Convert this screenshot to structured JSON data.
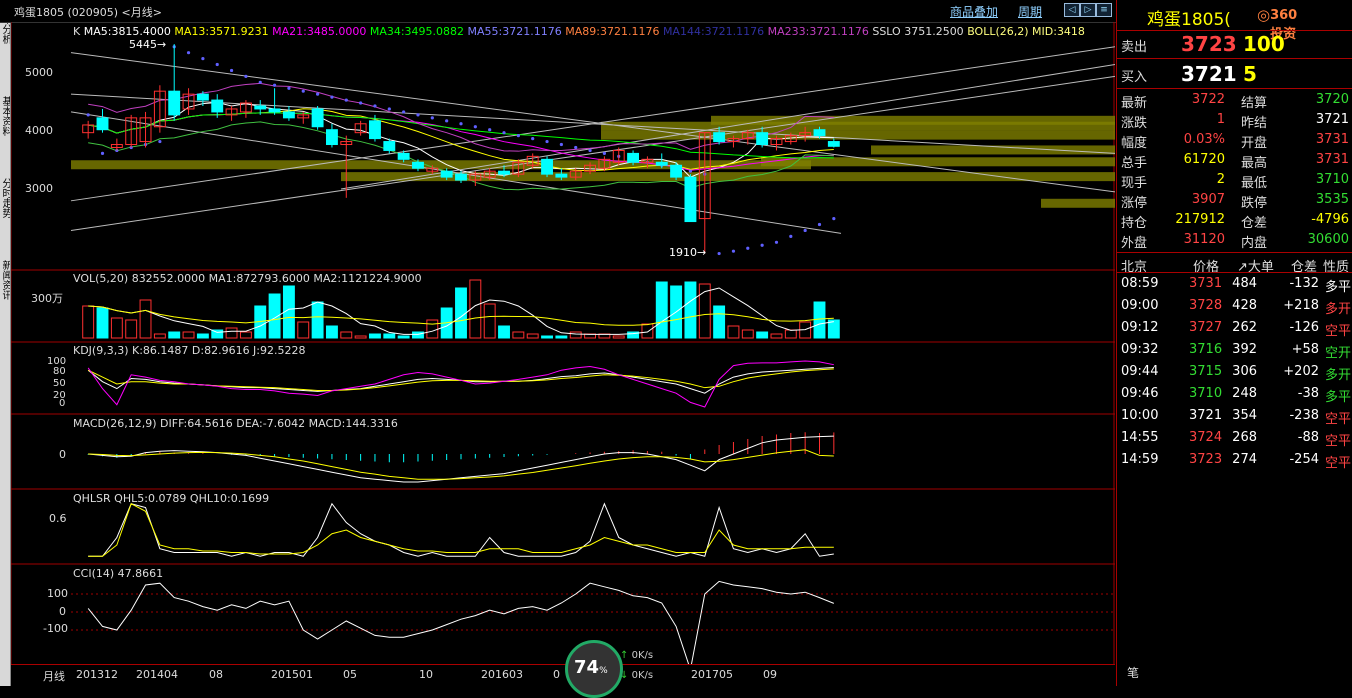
{
  "window": {
    "code_label": "鸡蛋1805 (020905) <月线>",
    "links": [
      "商品叠加",
      "周期"
    ]
  },
  "left_tabs": [
    "技术分析",
    "基本资料",
    "分时走势",
    "新闻资讯"
  ],
  "main": {
    "header": "K  MA5:3815.4000  MA13:3571.9231  MA21:3485.0000  MA34:3495.0882  MA55:3721.1176  MA89:3721.1176  MA144:3721.1176  MA233:3721.1176  SSLO 3751.2500  BOLL(26,2) MID:3418",
    "header_items": [
      {
        "t": "K",
        "c": "#ddd"
      },
      {
        "t": "MA5:3815.4000",
        "c": "#ffffff"
      },
      {
        "t": "MA13:3571.9231",
        "c": "#ffff00"
      },
      {
        "t": "MA21:3485.0000",
        "c": "#ff00ff"
      },
      {
        "t": "MA34:3495.0882",
        "c": "#00ff00"
      },
      {
        "t": "MA55:3721.1176",
        "c": "#8080ff"
      },
      {
        "t": "MA89:3721.1176",
        "c": "#ff8040"
      },
      {
        "t": "MA144:3721.1176",
        "c": "#3030a0"
      },
      {
        "t": "MA233:3721.1176",
        "c": "#c040c0"
      },
      {
        "t": "SSLO 3751.2500",
        "c": "#ddd"
      },
      {
        "t": "BOLL(26,2) MID:3418",
        "c": "#ffff80"
      }
    ],
    "y_labels": [
      "5000",
      "4000",
      "3000"
    ],
    "y_values": [
      5000,
      4000,
      3000
    ],
    "price_range": [
      1700,
      5750
    ],
    "high_marker": "5445",
    "low_marker": "1910"
  },
  "vol": {
    "header": "VOL(5,20) 832552.0000  MA1:872793.6000  MA2:1121224.9000",
    "y_label": "300万"
  },
  "kdj": {
    "header": "KDJ(9,3,3) K:86.1487  D:82.9616  J:92.5228",
    "y_labels": [
      "100",
      "80",
      "50",
      "20",
      "0"
    ]
  },
  "macd": {
    "header": "MACD(26,12,9) DIFF:64.5616  DEA:-7.6042  MACD:144.3316",
    "y_label": "0"
  },
  "qhlsr": {
    "header": "QHLSR  QHL5:0.0789  QHL10:0.1699",
    "y_label": "0.6"
  },
  "cci": {
    "header": "CCI(14) 47.8661",
    "y_labels": [
      "100",
      "0",
      "-100"
    ]
  },
  "x_axis": {
    "period": "月线",
    "labels": [
      "201312",
      "201404",
      "08",
      "201501",
      "05",
      "10",
      "201603",
      "0",
      "201705",
      "09"
    ]
  },
  "gauge": {
    "value": "74",
    "unit": "%",
    "up": "0K/s",
    "down": "0K/s"
  },
  "chart_data": {
    "type": "candlestick",
    "title": "鸡蛋1805 (020905) <月线>",
    "ylim": [
      1700,
      5750
    ],
    "candles": [
      {
        "o": 3950,
        "h": 4150,
        "l": 3850,
        "c": 4080
      },
      {
        "o": 4200,
        "h": 4350,
        "l": 3950,
        "c": 4000
      },
      {
        "o": 3700,
        "h": 3850,
        "l": 3650,
        "c": 3750
      },
      {
        "o": 3750,
        "h": 4250,
        "l": 3700,
        "c": 4200
      },
      {
        "o": 3800,
        "h": 4300,
        "l": 3700,
        "c": 4200
      },
      {
        "o": 4050,
        "h": 4750,
        "l": 3950,
        "c": 4650
      },
      {
        "o": 4650,
        "h": 5445,
        "l": 4150,
        "c": 4250
      },
      {
        "o": 4350,
        "h": 4700,
        "l": 4250,
        "c": 4600
      },
      {
        "o": 4600,
        "h": 4650,
        "l": 4400,
        "c": 4500
      },
      {
        "o": 4500,
        "h": 4600,
        "l": 4200,
        "c": 4300
      },
      {
        "o": 4250,
        "h": 4400,
        "l": 4150,
        "c": 4350
      },
      {
        "o": 4300,
        "h": 4500,
        "l": 4200,
        "c": 4450
      },
      {
        "o": 4400,
        "h": 4500,
        "l": 4250,
        "c": 4350
      },
      {
        "o": 4350,
        "h": 4700,
        "l": 4250,
        "c": 4300
      },
      {
        "o": 4300,
        "h": 4400,
        "l": 4150,
        "c": 4200
      },
      {
        "o": 4200,
        "h": 4300,
        "l": 4100,
        "c": 4250
      },
      {
        "o": 4350,
        "h": 4400,
        "l": 4000,
        "c": 4050
      },
      {
        "o": 4000,
        "h": 4100,
        "l": 3700,
        "c": 3750
      },
      {
        "o": 3750,
        "h": 3900,
        "l": 2850,
        "c": 3800
      },
      {
        "o": 3950,
        "h": 4150,
        "l": 3900,
        "c": 4100
      },
      {
        "o": 4150,
        "h": 4250,
        "l": 3800,
        "c": 3850
      },
      {
        "o": 3800,
        "h": 3850,
        "l": 3600,
        "c": 3650
      },
      {
        "o": 3600,
        "h": 3650,
        "l": 3450,
        "c": 3500
      },
      {
        "o": 3450,
        "h": 3500,
        "l": 3300,
        "c": 3350
      },
      {
        "o": 3300,
        "h": 3400,
        "l": 3250,
        "c": 3350
      },
      {
        "o": 3300,
        "h": 3350,
        "l": 3150,
        "c": 3200
      },
      {
        "o": 3250,
        "h": 3300,
        "l": 3100,
        "c": 3150
      },
      {
        "o": 3150,
        "h": 3300,
        "l": 3050,
        "c": 3250
      },
      {
        "o": 3200,
        "h": 3350,
        "l": 3150,
        "c": 3300
      },
      {
        "o": 3300,
        "h": 3400,
        "l": 3200,
        "c": 3250
      },
      {
        "o": 3250,
        "h": 3500,
        "l": 3200,
        "c": 3450
      },
      {
        "o": 3400,
        "h": 3600,
        "l": 3350,
        "c": 3550
      },
      {
        "o": 3500,
        "h": 3550,
        "l": 3200,
        "c": 3250
      },
      {
        "o": 3250,
        "h": 3350,
        "l": 3150,
        "c": 3200
      },
      {
        "o": 3200,
        "h": 3350,
        "l": 3150,
        "c": 3300
      },
      {
        "o": 3300,
        "h": 3450,
        "l": 3250,
        "c": 3400
      },
      {
        "o": 3350,
        "h": 3550,
        "l": 3300,
        "c": 3500
      },
      {
        "o": 3450,
        "h": 3700,
        "l": 3400,
        "c": 3650
      },
      {
        "o": 3600,
        "h": 3650,
        "l": 3400,
        "c": 3450
      },
      {
        "o": 3450,
        "h": 3550,
        "l": 3350,
        "c": 3500
      },
      {
        "o": 3450,
        "h": 3600,
        "l": 3350,
        "c": 3400
      },
      {
        "o": 3400,
        "h": 3450,
        "l": 3150,
        "c": 3200
      },
      {
        "o": 3200,
        "h": 3250,
        "l": 2450,
        "c": 2450
      },
      {
        "o": 2500,
        "h": 3950,
        "l": 1910,
        "c": 3950
      },
      {
        "o": 3950,
        "h": 4050,
        "l": 3750,
        "c": 3800
      },
      {
        "o": 3800,
        "h": 3900,
        "l": 3700,
        "c": 3850
      },
      {
        "o": 3850,
        "h": 4000,
        "l": 3750,
        "c": 3950
      },
      {
        "o": 3950,
        "h": 4050,
        "l": 3700,
        "c": 3750
      },
      {
        "o": 3750,
        "h": 3900,
        "l": 3650,
        "c": 3850
      },
      {
        "o": 3800,
        "h": 3950,
        "l": 3750,
        "c": 3900
      },
      {
        "o": 3900,
        "h": 4050,
        "l": 3800,
        "c": 3950
      },
      {
        "o": 4000,
        "h": 4050,
        "l": 3850,
        "c": 3900
      },
      {
        "o": 3800,
        "h": 3850,
        "l": 3700,
        "c": 3720
      }
    ],
    "volume": [
      1.6,
      1.5,
      1.0,
      0.9,
      1.9,
      0.2,
      0.3,
      0.3,
      0.2,
      0.4,
      0.5,
      0.3,
      1.6,
      2.2,
      2.6,
      0.8,
      1.8,
      0.6,
      0.3,
      0.1,
      0.2,
      0.2,
      0.1,
      0.3,
      0.9,
      1.5,
      2.5,
      2.9,
      1.7,
      0.6,
      0.3,
      0.2,
      0.1,
      0.1,
      0.3,
      0.2,
      0.2,
      0.1,
      0.3,
      0.7,
      2.8,
      2.6,
      2.8,
      2.7,
      1.6,
      0.6,
      0.4,
      0.3,
      0.2,
      0.4,
      0.8,
      1.8,
      0.9
    ],
    "kdj_k": [
      80,
      55,
      40,
      62,
      60,
      55,
      52,
      50,
      48,
      46,
      44,
      42,
      42,
      40,
      38,
      36,
      34,
      36,
      38,
      40,
      45,
      50,
      55,
      60,
      62,
      60,
      58,
      55,
      55,
      56,
      56,
      58,
      62,
      66,
      68,
      72,
      74,
      70,
      65,
      60,
      55,
      50,
      40,
      30,
      50,
      65,
      72,
      76,
      78,
      80,
      82,
      84,
      86
    ],
    "kdj_d": [
      80,
      65,
      50,
      55,
      55,
      52,
      50,
      50,
      48,
      46,
      45,
      44,
      43,
      42,
      40,
      38,
      36,
      36,
      37,
      39,
      42,
      46,
      50,
      54,
      57,
      58,
      58,
      57,
      56,
      56,
      56,
      57,
      59,
      62,
      64,
      67,
      70,
      69,
      67,
      64,
      60,
      56,
      50,
      42,
      45,
      55,
      63,
      68,
      72,
      76,
      79,
      81,
      83
    ],
    "kdj_j": [
      85,
      40,
      5,
      70,
      65,
      58,
      55,
      50,
      48,
      45,
      40,
      38,
      38,
      35,
      30,
      28,
      25,
      35,
      40,
      45,
      50,
      60,
      70,
      75,
      72,
      65,
      58,
      50,
      52,
      56,
      60,
      65,
      70,
      80,
      85,
      88,
      82,
      70,
      60,
      50,
      40,
      30,
      10,
      0,
      60,
      90,
      95,
      96,
      96,
      98,
      100,
      98,
      92
    ],
    "macd_bars": [
      -5,
      -15,
      -25,
      -10,
      10,
      15,
      10,
      5,
      5,
      0,
      -5,
      -10,
      -10,
      -15,
      -20,
      -25,
      -30,
      -35,
      -40,
      -45,
      -50,
      -55,
      -55,
      -50,
      -45,
      -40,
      -35,
      -30,
      -25,
      -20,
      -15,
      -10,
      -5,
      0,
      5,
      10,
      15,
      20,
      25,
      20,
      15,
      -10,
      -35,
      30,
      60,
      80,
      100,
      120,
      130,
      140,
      145,
      140,
      144
    ],
    "macd_diff": [
      0,
      -5,
      -10,
      -8,
      5,
      10,
      12,
      10,
      8,
      5,
      0,
      -5,
      -15,
      -25,
      -35,
      -45,
      -55,
      -65,
      -75,
      -85,
      -90,
      -95,
      -100,
      -100,
      -95,
      -90,
      -85,
      -80,
      -75,
      -70,
      -60,
      -50,
      -40,
      -30,
      -20,
      -10,
      0,
      5,
      5,
      0,
      -10,
      -20,
      -40,
      -60,
      -20,
      0,
      20,
      40,
      50,
      55,
      60,
      62,
      64
    ],
    "macd_dea": [
      0,
      -2,
      -5,
      -6,
      -3,
      0,
      3,
      5,
      6,
      5,
      3,
      0,
      -5,
      -10,
      -18,
      -25,
      -35,
      -45,
      -55,
      -65,
      -72,
      -80,
      -85,
      -90,
      -90,
      -90,
      -88,
      -85,
      -82,
      -78,
      -72,
      -66,
      -58,
      -50,
      -42,
      -33,
      -25,
      -18,
      -13,
      -10,
      -10,
      -12,
      -18,
      -28,
      -26,
      -20,
      -12,
      -4,
      4,
      10,
      15,
      -5,
      -7
    ],
    "qhl5": [
      0.05,
      0.05,
      0.3,
      0.75,
      0.7,
      0.15,
      0.1,
      0.1,
      0.1,
      0.1,
      0.05,
      0.1,
      0.05,
      0.1,
      0.1,
      0.05,
      0.3,
      0.75,
      0.5,
      0.35,
      0.25,
      0.2,
      0.1,
      0.05,
      0.1,
      0.05,
      0.05,
      0.05,
      0.3,
      0.1,
      0.05,
      0.05,
      0.05,
      0.05,
      0.1,
      0.25,
      0.75,
      0.3,
      0.2,
      0.15,
      0.1,
      0.05,
      0.1,
      0.05,
      0.7,
      0.15,
      0.1,
      0.15,
      0.1,
      0.15,
      0.35,
      0.05,
      0.08
    ],
    "qhl10": [
      0.05,
      0.05,
      0.2,
      0.75,
      0.65,
      0.2,
      0.15,
      0.15,
      0.12,
      0.12,
      0.1,
      0.1,
      0.08,
      0.08,
      0.08,
      0.1,
      0.2,
      0.35,
      0.4,
      0.3,
      0.25,
      0.2,
      0.15,
      0.12,
      0.12,
      0.1,
      0.1,
      0.1,
      0.15,
      0.15,
      0.15,
      0.1,
      0.1,
      0.1,
      0.15,
      0.2,
      0.3,
      0.25,
      0.2,
      0.2,
      0.15,
      0.1,
      0.1,
      0.1,
      0.4,
      0.2,
      0.15,
      0.15,
      0.15,
      0.15,
      0.17,
      0.17,
      0.17
    ],
    "cci": [
      20,
      -80,
      -100,
      10,
      150,
      160,
      80,
      60,
      30,
      10,
      40,
      20,
      60,
      40,
      60,
      -100,
      -150,
      -100,
      -50,
      -90,
      -130,
      -140,
      -140,
      -120,
      -100,
      -70,
      -40,
      -20,
      10,
      -10,
      20,
      30,
      10,
      50,
      100,
      160,
      140,
      120,
      90,
      80,
      50,
      -80,
      -320,
      100,
      170,
      150,
      140,
      130,
      110,
      100,
      110,
      80,
      48
    ],
    "sar": [
      4250,
      3600,
      3650,
      3700,
      3750,
      3800,
      5400,
      5300,
      5200,
      5100,
      5000,
      4900,
      4800,
      4750,
      4700,
      4650,
      4600,
      4550,
      4500,
      4450,
      4400,
      4350,
      4300,
      4250,
      4200,
      4150,
      4100,
      4050,
      4000,
      3950,
      3900,
      3850,
      3800,
      3750,
      3700,
      3650,
      3600,
      3550,
      3500,
      3450,
      3400,
      3350,
      3300,
      3250,
      1910,
      1950,
      2000,
      2050,
      2100,
      2200,
      2300,
      2400,
      2500
    ]
  },
  "right_panel": {
    "title": "鸡蛋1805(",
    "logo": "360投资",
    "ask_label": "卖出",
    "ask_price": "3723",
    "ask_vol": "100",
    "bid_label": "买入",
    "bid_price": "3721",
    "bid_vol": "5",
    "stats": [
      {
        "l1": "最新",
        "v1": "3722",
        "c1": "red",
        "l2": "结算",
        "v2": "3720",
        "c2": "green"
      },
      {
        "l1": "涨跌",
        "v1": "1",
        "c1": "red",
        "l2": "昨结",
        "v2": "3721",
        "c2": "white"
      },
      {
        "l1": "幅度",
        "v1": "0.03%",
        "c1": "red",
        "l2": "开盘",
        "v2": "3731",
        "c2": "red"
      },
      {
        "l1": "总手",
        "v1": "61720",
        "c1": "yellow",
        "l2": "最高",
        "v2": "3731",
        "c2": "red"
      },
      {
        "l1": "现手",
        "v1": "2",
        "c1": "yellow",
        "l2": "最低",
        "v2": "3710",
        "c2": "green"
      },
      {
        "l1": "涨停",
        "v1": "3907",
        "c1": "red",
        "l2": "跌停",
        "v2": "3535",
        "c2": "green"
      },
      {
        "l1": "持仓",
        "v1": "217912",
        "c1": "yellow",
        "l2": "仓差",
        "v2": "-4796",
        "c2": "yellow"
      },
      {
        "l1": "外盘",
        "v1": "31120",
        "c1": "red",
        "l2": "内盘",
        "v2": "30600",
        "c2": "green"
      }
    ],
    "ticks_header": [
      "北京",
      "价格",
      "↗大单",
      "仓差",
      "性质"
    ],
    "ticks": [
      {
        "time": "08:59",
        "price": "3731",
        "pc": "red",
        "vol": "484",
        "diff": "-132",
        "type": "多平",
        "tc": "white"
      },
      {
        "time": "09:00",
        "price": "3728",
        "pc": "red",
        "vol": "428",
        "diff": "+218",
        "type": "多开",
        "tc": "red"
      },
      {
        "time": "09:12",
        "price": "3727",
        "pc": "red",
        "vol": "262",
        "diff": "-126",
        "type": "空平",
        "tc": "red"
      },
      {
        "time": "09:32",
        "price": "3716",
        "pc": "green",
        "vol": "392",
        "diff": "+58",
        "type": "空开",
        "tc": "green"
      },
      {
        "time": "09:44",
        "price": "3715",
        "pc": "green",
        "vol": "306",
        "diff": "+202",
        "type": "多开",
        "tc": "green"
      },
      {
        "time": "09:46",
        "price": "3710",
        "pc": "green",
        "vol": "248",
        "diff": "-38",
        "type": "多平",
        "tc": "green"
      },
      {
        "time": "10:00",
        "price": "3721",
        "pc": "white",
        "vol": "354",
        "diff": "-238",
        "type": "空平",
        "tc": "red"
      },
      {
        "time": "14:55",
        "price": "3724",
        "pc": "red",
        "vol": "268",
        "diff": "-88",
        "type": "空平",
        "tc": "red"
      },
      {
        "time": "14:59",
        "price": "3723",
        "pc": "red",
        "vol": "274",
        "diff": "-254",
        "type": "空平",
        "tc": "red"
      }
    ],
    "footer": "笔"
  },
  "colors": {
    "up": "#ff3030",
    "down": "#00ffff",
    "grid": "#a00000",
    "band": "#808000"
  }
}
